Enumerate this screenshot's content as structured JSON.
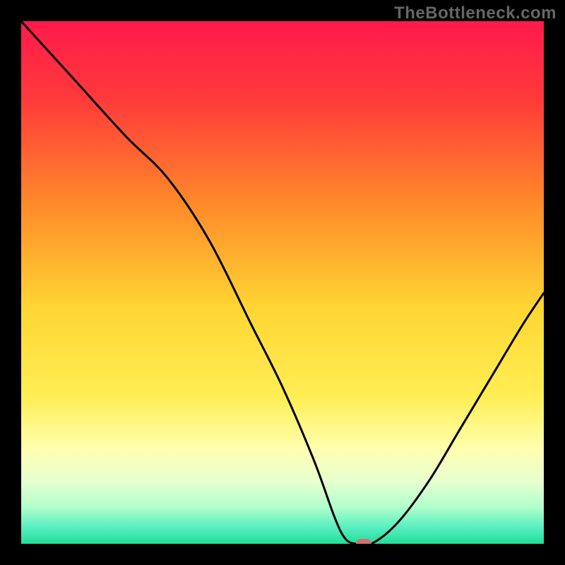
{
  "watermark": "TheBottleneck.com",
  "chart_data": {
    "type": "line",
    "title": "",
    "xlabel": "",
    "ylabel": "",
    "xlim": [
      0,
      100
    ],
    "ylim": [
      0,
      100
    ],
    "x": [
      0,
      10,
      20,
      28,
      36,
      44,
      50,
      56,
      60,
      62,
      64,
      67,
      72,
      78,
      84,
      90,
      96,
      100
    ],
    "values": [
      100,
      89,
      78,
      70,
      58,
      42,
      30,
      16,
      5,
      1,
      0,
      0,
      4,
      12,
      22,
      32,
      42,
      48
    ],
    "gradient_stops": [
      {
        "pos": 0.0,
        "color": "#ff1a4d"
      },
      {
        "pos": 0.15,
        "color": "#ff3a3a"
      },
      {
        "pos": 0.35,
        "color": "#ff8a2a"
      },
      {
        "pos": 0.55,
        "color": "#ffd633"
      },
      {
        "pos": 0.72,
        "color": "#ffee55"
      },
      {
        "pos": 0.82,
        "color": "#ffffb0"
      },
      {
        "pos": 0.88,
        "color": "#e8ffd0"
      },
      {
        "pos": 0.93,
        "color": "#b0ffcc"
      },
      {
        "pos": 0.97,
        "color": "#55eec0"
      },
      {
        "pos": 1.0,
        "color": "#22dd99"
      }
    ],
    "marker": {
      "x": 65.5,
      "y": 0,
      "color": "#d36f6f"
    }
  }
}
